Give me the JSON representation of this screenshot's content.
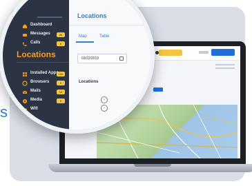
{
  "side_glyph": "s",
  "app": {
    "topbar_button": "",
    "map_markers": [
      "",
      ""
    ]
  },
  "sidebar": {
    "items": [
      {
        "label": "Dashboard",
        "icon": "home-icon",
        "count": ""
      },
      {
        "label": "Messages",
        "icon": "message-icon",
        "count": "86"
      },
      {
        "label": "Calls",
        "icon": "phone-icon",
        "count": "8"
      }
    ],
    "section_title": "Locations",
    "section_items": [
      {
        "label": "Installed Apps",
        "icon": "apps-icon",
        "count": "156"
      },
      {
        "label": "Browsers",
        "icon": "browser-icon",
        "count": "8"
      },
      {
        "label": "Mails",
        "icon": "mail-icon",
        "count": "19"
      },
      {
        "label": "Media",
        "icon": "media-icon",
        "count": "8"
      },
      {
        "label": "Wifi",
        "icon": "wifi-icon",
        "count": ""
      }
    ]
  },
  "panel": {
    "title": "Locations",
    "tabs": [
      "Map",
      "Table"
    ],
    "date_value": "03/22/2019",
    "card_title": "Locations",
    "zoom_in": "+",
    "zoom_out": "−"
  },
  "colors": {
    "accent": "#2f7fd0",
    "sidebar_bg": "#2c3443",
    "section_orange": "#ff9c1a",
    "badge_yellow": "#f5c542",
    "primary_button": "#1e6fd9"
  }
}
